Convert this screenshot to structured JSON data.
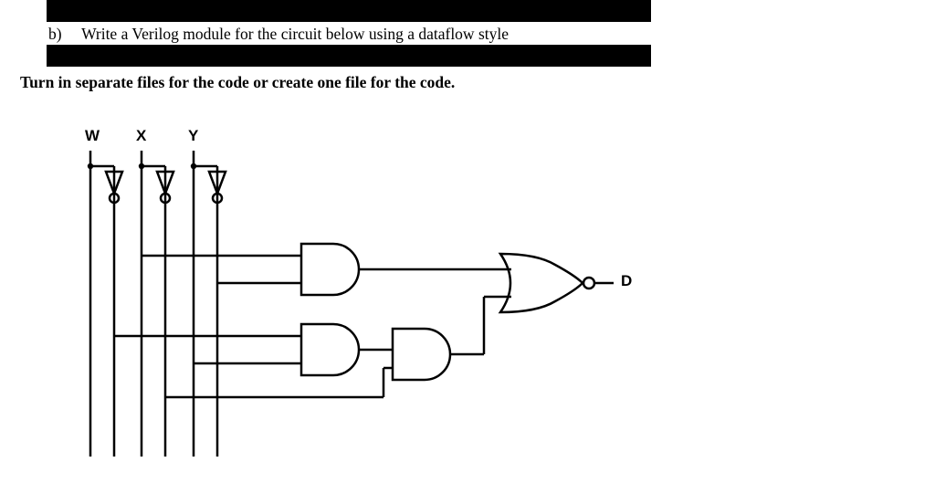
{
  "question": {
    "label": "b)",
    "text": "Write a Verilog module for the circuit below using a dataflow style"
  },
  "instruction": "Turn in separate files for the code or create one file for the code.",
  "circuit": {
    "inputs": {
      "w": "W",
      "x": "X",
      "y": "Y"
    },
    "output": "D"
  }
}
